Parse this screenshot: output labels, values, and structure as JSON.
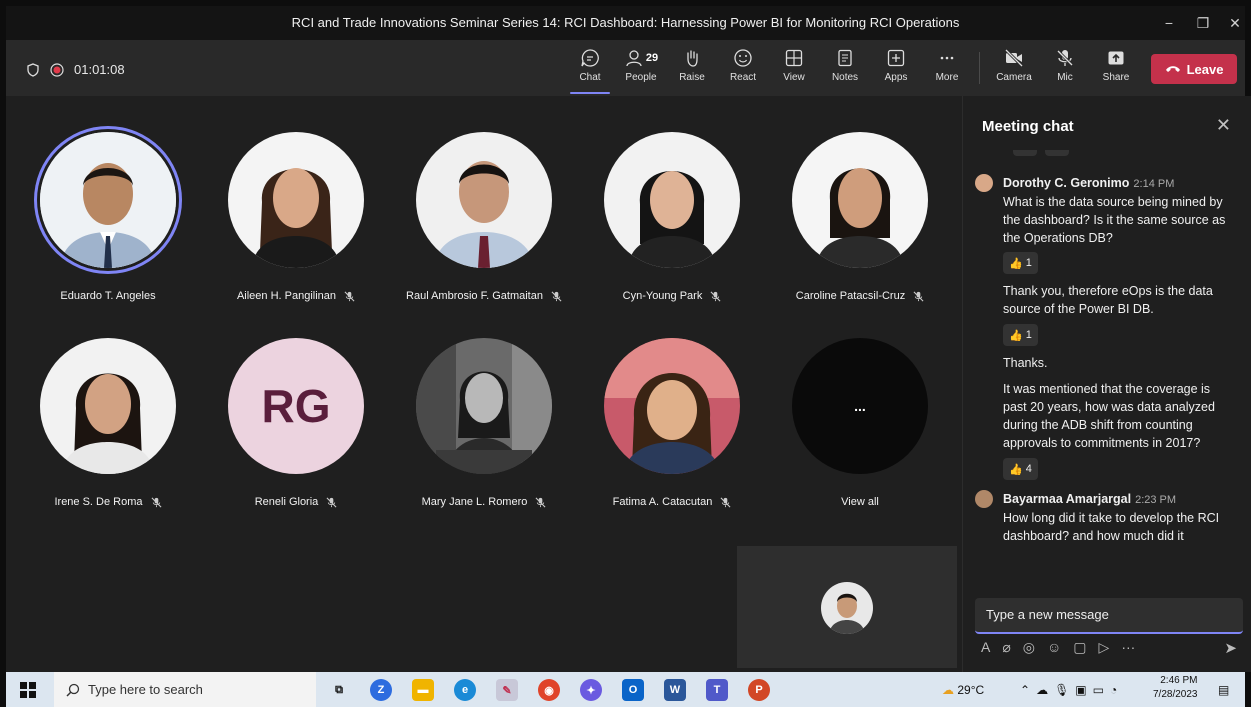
{
  "window": {
    "title": "RCI and Trade Innovations Seminar Series 14: RCI Dashboard: Harnessing Power BI for Monitoring RCI Operations",
    "minimize": "−",
    "restore": "❐",
    "close": "✕"
  },
  "toolbar": {
    "timer": "01:01:08",
    "people_count": "29",
    "buttons": [
      {
        "label": "Chat"
      },
      {
        "label": "People"
      },
      {
        "label": "Raise"
      },
      {
        "label": "React"
      },
      {
        "label": "View"
      },
      {
        "label": "Notes"
      },
      {
        "label": "Apps"
      },
      {
        "label": "More"
      },
      {
        "label": "Camera"
      },
      {
        "label": "Mic"
      },
      {
        "label": "Share"
      }
    ],
    "leave_label": "Leave"
  },
  "participants": [
    {
      "name": "Eduardo T. Angeles",
      "muted": false,
      "speaking": true
    },
    {
      "name": "Aileen H. Pangilinan",
      "muted": true
    },
    {
      "name": "Raul Ambrosio F. Gatmaitan",
      "muted": true
    },
    {
      "name": "Cyn-Young Park",
      "muted": true
    },
    {
      "name": "Caroline Patacsil-Cruz",
      "muted": true
    },
    {
      "name": "Irene S. De Roma",
      "muted": true
    },
    {
      "name": "Reneli Gloria",
      "muted": true,
      "initials": "RG"
    },
    {
      "name": "Mary Jane L. Romero",
      "muted": true
    },
    {
      "name": "Fatima A. Catacutan",
      "muted": true
    },
    {
      "name": "View all",
      "more": "..."
    }
  ],
  "chat": {
    "header": "Meeting chat",
    "close": "✕",
    "messages": [
      {
        "author": "Dorothy C. Geronimo",
        "time": "2:14 PM",
        "text": "What is the data source being mined by the dashboard?  Is it the same source as the Operations DB?",
        "reaction": "1"
      },
      {
        "text": "Thank you, therefore eOps is the data source of the Power BI DB.",
        "reaction": "1"
      },
      {
        "text": "Thanks."
      },
      {
        "text": "It was mentioned that the coverage is  past 20 years, how was data analyzed during the ADB shift from counting approvals to commitments in 2017?",
        "reaction": "4"
      },
      {
        "author": "Bayarmaa Amarjargal",
        "time": "2:23 PM",
        "text": "How long did it take to develop the RCI dashboard? and how much did it"
      }
    ],
    "compose_placeholder": "Type a new message",
    "compose_more": "···"
  },
  "taskbar": {
    "search_placeholder": "Type here to search",
    "weather": "29°C",
    "time": "2:46 PM",
    "date": "7/28/2023"
  },
  "colors": {
    "accent": "#7f85f5",
    "leave": "#c4314b",
    "stage": "#1f1f1f",
    "toolbar": "#292929"
  }
}
